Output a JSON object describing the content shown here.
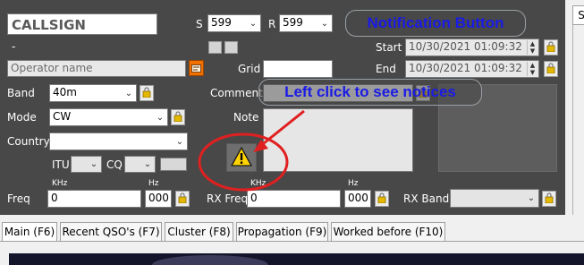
{
  "callsign": {
    "placeholder": "CALLSIGN"
  },
  "rst": {
    "s_label": "S",
    "s_value": "599",
    "r_label": "R",
    "r_value": "599"
  },
  "notification_button": {
    "label": "Notification Button"
  },
  "dash": "-",
  "operator": {
    "placeholder": "Operator name"
  },
  "grid": {
    "label": "Grid",
    "value": ""
  },
  "start": {
    "label": "Start",
    "value": "10/30/2021 01:09:32"
  },
  "end": {
    "label": "End",
    "value": "10/30/2021 01:09:32"
  },
  "band": {
    "label": "Band",
    "value": "40m"
  },
  "comment": {
    "label": "Comment",
    "value": ""
  },
  "annotation": {
    "text": "Left click to see notices"
  },
  "mode": {
    "label": "Mode",
    "value": "CW"
  },
  "note": {
    "label": "Note",
    "value": ""
  },
  "country": {
    "label": "Country",
    "value": ""
  },
  "itu": {
    "label": "ITU",
    "value": ""
  },
  "cq": {
    "label": "CQ",
    "value": ""
  },
  "freq": {
    "label": "Freq",
    "khz_label": "KHz",
    "hz_label": "Hz",
    "khz_value": "0",
    "hz_value": "000"
  },
  "rx_freq": {
    "label": "RX Freq",
    "khz_label": "KHz",
    "hz_label": "Hz",
    "khz_value": "0",
    "hz_value": "000"
  },
  "rx_band": {
    "label": "RX Band",
    "value": ""
  },
  "right_tab": {
    "label": "S"
  },
  "tabs": [
    {
      "label": "Main (F6)"
    },
    {
      "label": "Recent QSO's (F7)"
    },
    {
      "label": "Cluster (F8)"
    },
    {
      "label": "Propagation (F9)"
    },
    {
      "label": "Worked before (F10)"
    }
  ],
  "colors": {
    "panel": "#484848",
    "annotation_blue": "#1a1ae6",
    "annotation_red": "#e02020",
    "warning_yellow": "#ffd400"
  },
  "icons": [
    "lock-icon",
    "warning-icon",
    "dropdown-arrow-icon",
    "operator-card-icon"
  ]
}
